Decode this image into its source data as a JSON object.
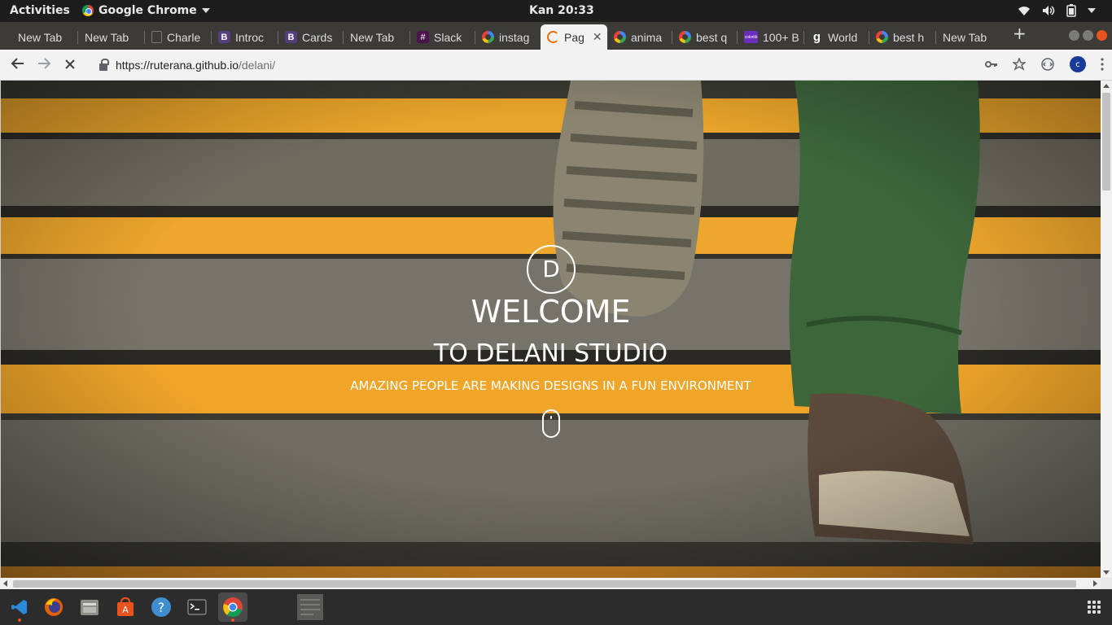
{
  "system_bar": {
    "activities": "Activities",
    "app_name": "Google Chrome",
    "clock": "Kan 20:33"
  },
  "tabs": [
    {
      "label": "New Tab",
      "icon": "none"
    },
    {
      "label": "New Tab",
      "icon": "none"
    },
    {
      "label": "Charle",
      "icon": "doc-icon"
    },
    {
      "label": "Introc",
      "icon": "bootstrap-icon"
    },
    {
      "label": "Cards",
      "icon": "bootstrap-icon"
    },
    {
      "label": "New Tab",
      "icon": "none"
    },
    {
      "label": "Slack",
      "icon": "slack-icon"
    },
    {
      "label": "instag",
      "icon": "google-icon"
    },
    {
      "label": "Pag",
      "icon": "loading-icon",
      "active": true
    },
    {
      "label": "anima",
      "icon": "google-icon"
    },
    {
      "label": "best q",
      "icon": "google-icon"
    },
    {
      "label": "100+ B",
      "icon": "colorlib-icon"
    },
    {
      "label": "World",
      "icon": "goodreads-icon"
    },
    {
      "label": "best h",
      "icon": "google-icon"
    },
    {
      "label": "New Tab",
      "icon": "none"
    }
  ],
  "toolbar": {
    "url_host": "https://ruterana.github.io",
    "url_path": "/delani/",
    "profile_initial": "c"
  },
  "hero": {
    "logo_letter": "D",
    "title": "WELCOME",
    "subtitle": "TO DELANI STUDIO",
    "tagline": "AMAZING PEOPLE ARE MAKING DESIGNS IN A FUN ENVIRONMENT"
  },
  "dock": {
    "items": [
      "vscode-icon",
      "firefox-icon",
      "files-icon",
      "software-center-icon",
      "help-icon",
      "terminal-icon",
      "chrome-icon",
      "document-icon"
    ]
  },
  "colors": {
    "accent_orange": "#e9541e",
    "stripe_yellow": "#f0a52a",
    "step_grey": "#6f6c62",
    "jeans_green": "#3f6a3c"
  }
}
